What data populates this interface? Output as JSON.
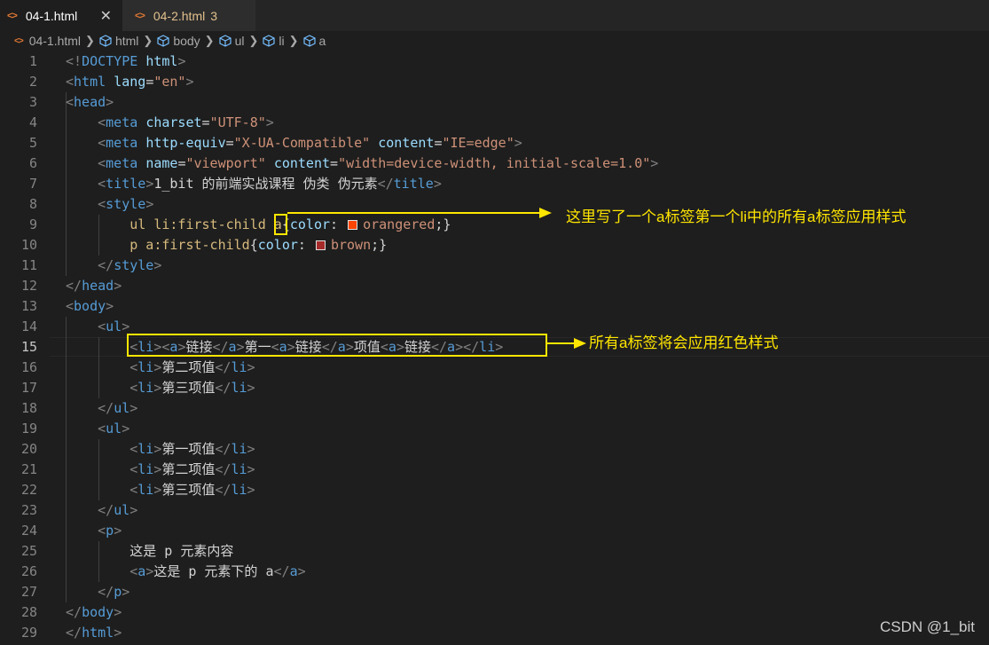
{
  "tabs": [
    {
      "label": "04-1.html",
      "active": true,
      "close": "✕"
    },
    {
      "label": "04-2.html",
      "active": false,
      "problems": "3"
    }
  ],
  "file_icon_glyph": "<>",
  "breadcrumb": [
    "04-1.html",
    "html",
    "body",
    "ul",
    "li",
    "a"
  ],
  "current_line": 15,
  "lines": [
    {
      "n": "1",
      "html": "<span class='p'>&lt;!</span><span class='t'>DOCTYPE</span> <span class='at'>html</span><span class='p'>&gt;</span>"
    },
    {
      "n": "2",
      "html": "<span class='p'>&lt;</span><span class='t'>html</span> <span class='at'>lang</span>=<span class='s'>\"en\"</span><span class='p'>&gt;</span>"
    },
    {
      "n": "3",
      "html": "<span class='p'>&lt;</span><span class='t'>head</span><span class='p'>&gt;</span>"
    },
    {
      "n": "4",
      "html": "    <span class='p'>&lt;</span><span class='t'>meta</span> <span class='at'>charset</span>=<span class='s'>\"UTF-8\"</span><span class='p'>&gt;</span>"
    },
    {
      "n": "5",
      "html": "    <span class='p'>&lt;</span><span class='t'>meta</span> <span class='at'>http-equiv</span>=<span class='s'>\"X-UA-Compatible\"</span> <span class='at'>content</span>=<span class='s'>\"IE=edge\"</span><span class='p'>&gt;</span>"
    },
    {
      "n": "6",
      "html": "    <span class='p'>&lt;</span><span class='t'>meta</span> <span class='at'>name</span>=<span class='s'>\"viewport\"</span> <span class='at'>content</span>=<span class='s'>\"width=device-width, initial-scale=1.0\"</span><span class='p'>&gt;</span>"
    },
    {
      "n": "7",
      "html": "    <span class='p'>&lt;</span><span class='t'>title</span><span class='p'>&gt;</span>1_bit 的前端实战课程 伪类 伪元素<span class='p'>&lt;/</span><span class='t'>title</span><span class='p'>&gt;</span>"
    },
    {
      "n": "8",
      "html": "    <span class='p'>&lt;</span><span class='t'>style</span><span class='p'>&gt;</span>"
    },
    {
      "n": "9",
      "html": "        <span class='sel'>ul li:first-child a</span>{<span class='prop'>color</span>: <span class='sw' style='background:#ff4500'></span><span class='val'>orangered</span>;}"
    },
    {
      "n": "10",
      "html": "        <span class='sel'>p a:first-child</span>{<span class='prop'>color</span>: <span class='sw' style='background:#a52a2a'></span><span class='val'>brown</span>;}"
    },
    {
      "n": "11",
      "html": "    <span class='p'>&lt;/</span><span class='t'>style</span><span class='p'>&gt;</span>"
    },
    {
      "n": "12",
      "html": "<span class='p'>&lt;/</span><span class='t'>head</span><span class='p'>&gt;</span>"
    },
    {
      "n": "13",
      "html": "<span class='p'>&lt;</span><span class='t'>body</span><span class='p'>&gt;</span>"
    },
    {
      "n": "14",
      "html": "    <span class='p'>&lt;</span><span class='t'>ul</span><span class='p'>&gt;</span>"
    },
    {
      "n": "15",
      "html": "        <span class='p'>&lt;</span><span class='t'>li</span><span class='p'>&gt;&lt;</span><span class='t'>a</span><span class='p'>&gt;</span>链接<span class='p'>&lt;/</span><span class='t'>a</span><span class='p'>&gt;</span>第一<span class='p'>&lt;</span><span class='t'>a</span><span class='p'>&gt;</span>链接<span class='p'>&lt;/</span><span class='t'>a</span><span class='p'>&gt;</span>项值<span class='p'>&lt;</span><span class='t'>a</span><span class='p'>&gt;</span>链接<span class='p'>&lt;/</span><span class='t'>a</span><span class='p'>&gt;&lt;/</span><span class='t'>li</span><span class='p'>&gt;</span>"
    },
    {
      "n": "16",
      "html": "        <span class='p'>&lt;</span><span class='t'>li</span><span class='p'>&gt;</span>第二项值<span class='p'>&lt;/</span><span class='t'>li</span><span class='p'>&gt;</span>"
    },
    {
      "n": "17",
      "html": "        <span class='p'>&lt;</span><span class='t'>li</span><span class='p'>&gt;</span>第三项值<span class='p'>&lt;/</span><span class='t'>li</span><span class='p'>&gt;</span>"
    },
    {
      "n": "18",
      "html": "    <span class='p'>&lt;/</span><span class='t'>ul</span><span class='p'>&gt;</span>"
    },
    {
      "n": "19",
      "html": "    <span class='p'>&lt;</span><span class='t'>ul</span><span class='p'>&gt;</span>"
    },
    {
      "n": "20",
      "html": "        <span class='p'>&lt;</span><span class='t'>li</span><span class='p'>&gt;</span>第一项值<span class='p'>&lt;/</span><span class='t'>li</span><span class='p'>&gt;</span>"
    },
    {
      "n": "21",
      "html": "        <span class='p'>&lt;</span><span class='t'>li</span><span class='p'>&gt;</span>第二项值<span class='p'>&lt;/</span><span class='t'>li</span><span class='p'>&gt;</span>"
    },
    {
      "n": "22",
      "html": "        <span class='p'>&lt;</span><span class='t'>li</span><span class='p'>&gt;</span>第三项值<span class='p'>&lt;/</span><span class='t'>li</span><span class='p'>&gt;</span>"
    },
    {
      "n": "23",
      "html": "    <span class='p'>&lt;/</span><span class='t'>ul</span><span class='p'>&gt;</span>"
    },
    {
      "n": "24",
      "html": "    <span class='p'>&lt;</span><span class='t'>p</span><span class='p'>&gt;</span>"
    },
    {
      "n": "25",
      "html": "        这是 p 元素内容"
    },
    {
      "n": "26",
      "html": "        <span class='p'>&lt;</span><span class='t'>a</span><span class='p'>&gt;</span>这是 p 元素下的 a<span class='p'>&lt;/</span><span class='t'>a</span><span class='p'>&gt;</span>"
    },
    {
      "n": "27",
      "html": "    <span class='p'>&lt;/</span><span class='t'>p</span><span class='p'>&gt;</span>"
    },
    {
      "n": "28",
      "html": "<span class='p'>&lt;/</span><span class='t'>body</span><span class='p'>&gt;</span>"
    },
    {
      "n": "29",
      "html": "<span class='p'>&lt;/</span><span class='t'>html</span><span class='p'>&gt;</span>"
    }
  ],
  "annotations": {
    "selector_note": "这里写了一个a标签第一个li中的所有a标签应用样式",
    "red_style_note": "所有a标签将会应用红色样式"
  },
  "watermark": "CSDN @1_bit",
  "colors": {
    "accent_yellow": "#ffe600",
    "orangered": "#ff4500",
    "brown": "#a52a2a"
  }
}
